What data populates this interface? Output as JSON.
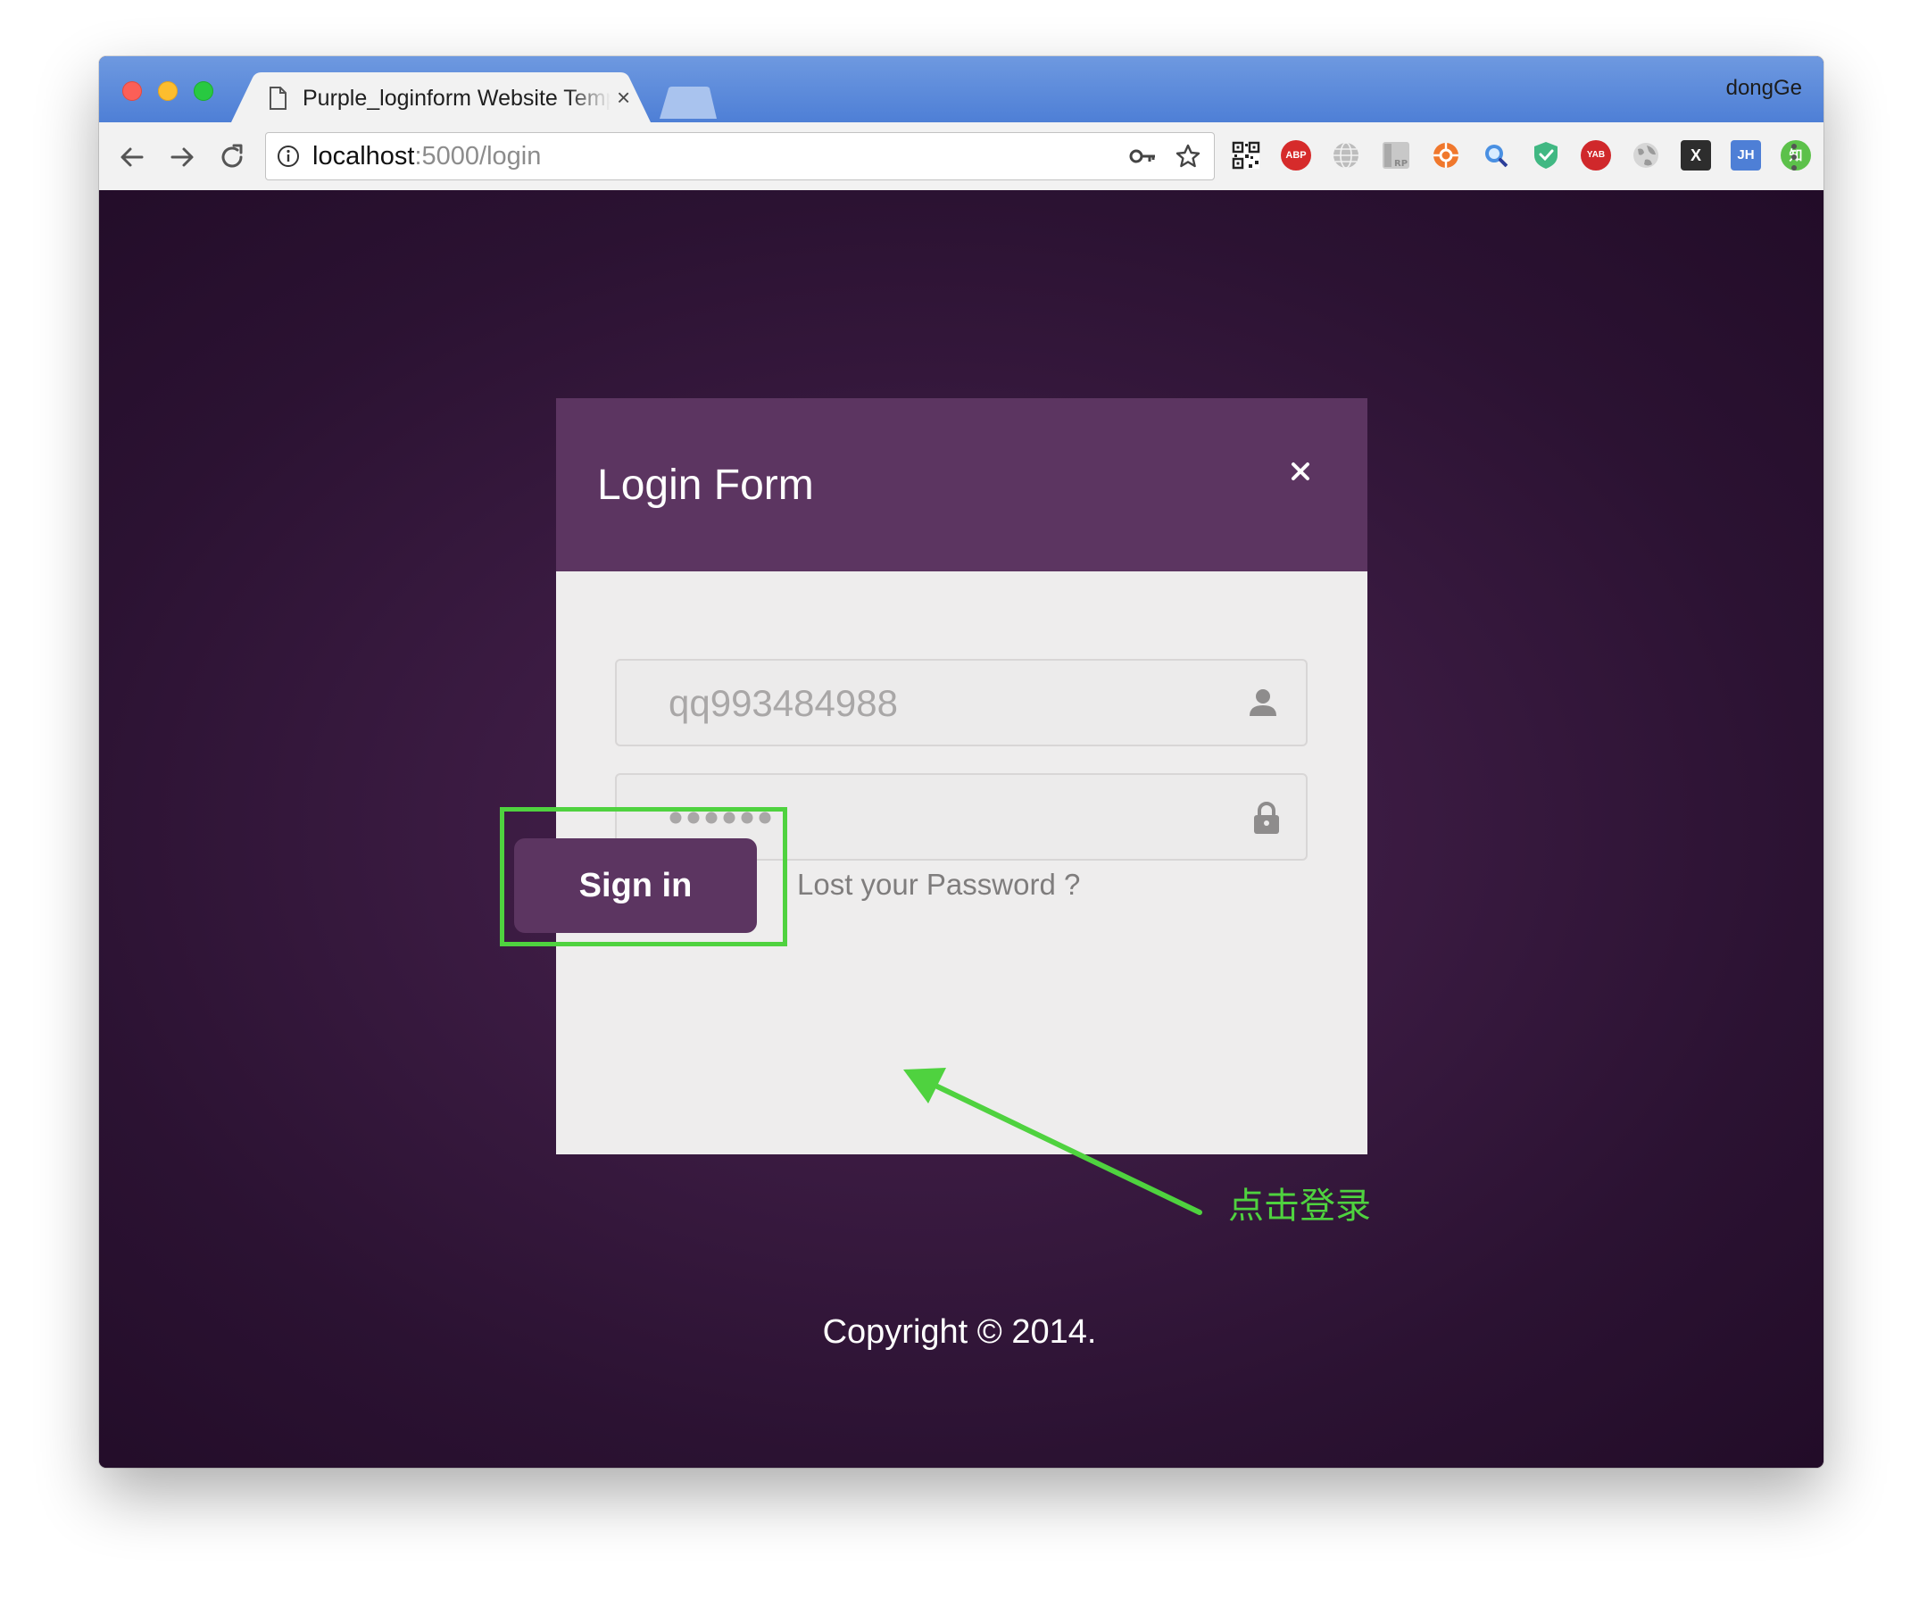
{
  "browser": {
    "tab_title": "Purple_loginform Website Template",
    "tab_close": "×",
    "profile_name": "dongGe",
    "url_host": "localhost",
    "url_path": ":5000/login",
    "extensions": [
      "qr-code-icon",
      "adblock-icon",
      "globe-icon",
      "rp-icon",
      "orange-extension-icon",
      "search-extension-icon",
      "vue-devtools-icon",
      "yab-icon",
      "grey-globe-icon",
      "x-extension-icon",
      "jh-extension-icon",
      "zhihu-icon",
      "metamask-icon"
    ],
    "extension_labels": {
      "adblock": "ABP",
      "yab": "YAB",
      "x": "X",
      "jh": "JH",
      "zhihu": "知"
    }
  },
  "modal": {
    "title": "Login Form",
    "close_label": "×",
    "username_value": "qq993484988",
    "password_mask": "●●●●●●",
    "signin_label": "Sign in",
    "lost_password_label": "Lost your Password ?"
  },
  "annotation": {
    "text": "点击登录",
    "color": "#4fd23f"
  },
  "footer": {
    "copyright": "Copyright © 2014."
  },
  "colors": {
    "header_purple": "#5c3561",
    "button_purple": "#5c3561",
    "page_background": "#2b1232",
    "highlight_green": "#4fd23f"
  }
}
